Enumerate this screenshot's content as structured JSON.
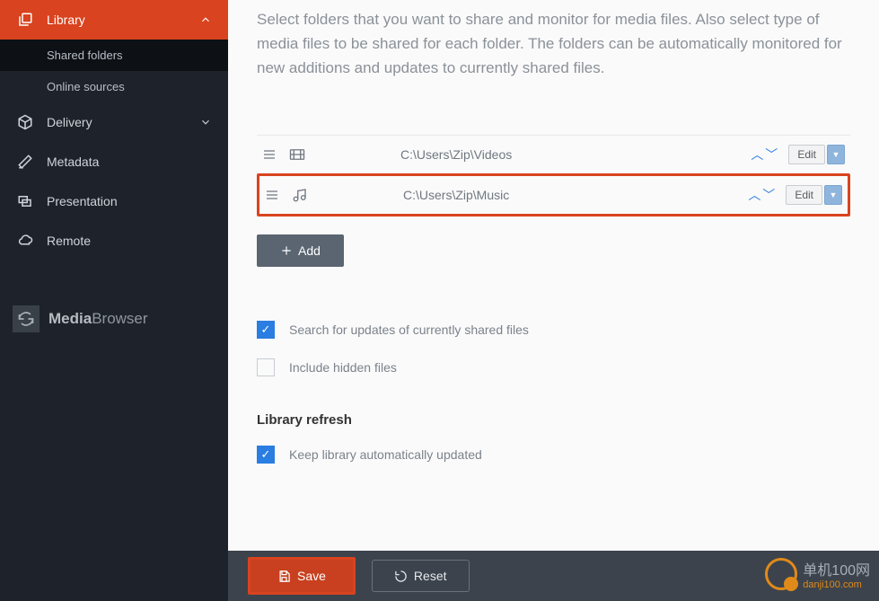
{
  "sidebar": {
    "items": [
      {
        "label": "Library"
      },
      {
        "label": "Delivery"
      },
      {
        "label": "Metadata"
      },
      {
        "label": "Presentation"
      },
      {
        "label": "Remote"
      }
    ],
    "subitems": [
      {
        "label": "Shared folders"
      },
      {
        "label": "Online sources"
      }
    ],
    "logo_a": "Media",
    "logo_b": "Browser"
  },
  "main": {
    "description": "Select folders that you want to share and monitor for media files. Also select type of media files to be shared for each folder. The folders can be automatically monitored for new additions and updates to currently shared files.",
    "folders": [
      {
        "path": "C:\\Users\\Zip\\Videos",
        "type": "video"
      },
      {
        "path": "C:\\Users\\Zip\\Music",
        "type": "music"
      }
    ],
    "edit_label": "Edit",
    "add_label": "Add",
    "opt_search": "Search for updates of currently shared files",
    "opt_hidden": "Include hidden files",
    "refresh_title": "Library refresh",
    "opt_auto": "Keep library automatically updated"
  },
  "footer": {
    "save": "Save",
    "reset": "Reset"
  },
  "watermark": {
    "text": "单机100网",
    "sub": "danji100.com"
  }
}
